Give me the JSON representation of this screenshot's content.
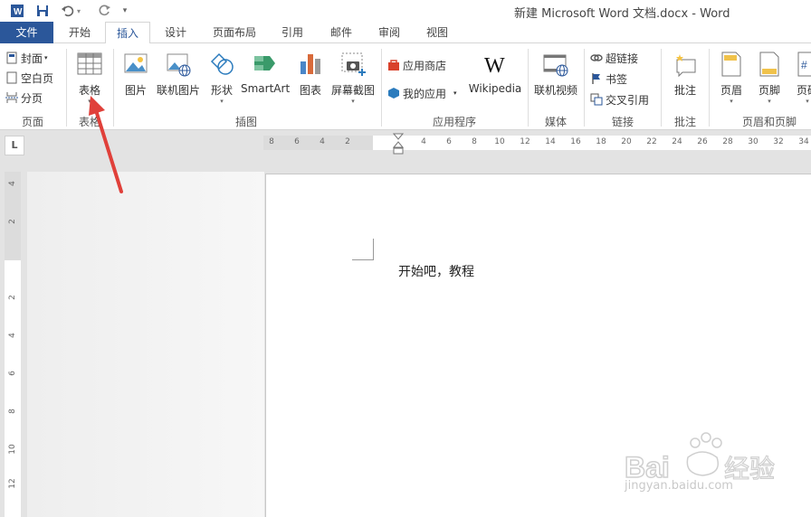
{
  "titlebar": {
    "title": "新建 Microsoft Word 文档.docx - Word",
    "quick_access": [
      "word-icon",
      "save-icon",
      "undo-icon",
      "redo-icon",
      "customize-icon"
    ]
  },
  "tabs": [
    {
      "label": "文件"
    },
    {
      "label": "开始"
    },
    {
      "label": "插入"
    },
    {
      "label": "设计"
    },
    {
      "label": "页面布局"
    },
    {
      "label": "引用"
    },
    {
      "label": "邮件"
    },
    {
      "label": "审阅"
    },
    {
      "label": "视图"
    }
  ],
  "ribbon": {
    "pages": {
      "label": "页面",
      "cover": "封面",
      "blank": "空白页",
      "break": "分页"
    },
    "table": {
      "label": "表格",
      "table_btn": "表格"
    },
    "illustrations": {
      "label": "插图",
      "picture": "图片",
      "online_picture": "联机图片",
      "shapes": "形状",
      "smartart": "SmartArt",
      "chart": "图表",
      "screenshot": "屏幕截图"
    },
    "apps": {
      "label": "应用程序",
      "store": "应用商店",
      "my_apps": "我的应用",
      "wikipedia": "Wikipedia"
    },
    "media": {
      "label": "媒体",
      "online_video": "联机视频"
    },
    "links": {
      "label": "链接",
      "hyperlink": "超链接",
      "bookmark": "书签",
      "cross_ref": "交叉引用"
    },
    "comments": {
      "label": "批注",
      "comment": "批注"
    },
    "header_footer": {
      "label": "页眉和页脚",
      "header": "页眉",
      "footer": "页脚",
      "page_num": "页码"
    }
  },
  "ruler": {
    "corner": "L",
    "h_left": [
      "8",
      "6",
      "4",
      "2"
    ],
    "h_right": [
      "4",
      "6",
      "8",
      "10",
      "12",
      "14",
      "16",
      "18",
      "20",
      "22",
      "24",
      "26",
      "28",
      "30",
      "32",
      "34"
    ],
    "v_top": [
      "4",
      "2"
    ],
    "v_bottom": [
      "2",
      "4",
      "6",
      "8",
      "10",
      "12"
    ]
  },
  "document": {
    "text": "开始吧，教程"
  },
  "watermark": {
    "brand": "Bai 经验",
    "url": "jingyan.baidu.com"
  },
  "colors": {
    "accent": "#2b579a",
    "arrow": "#e0403a"
  }
}
